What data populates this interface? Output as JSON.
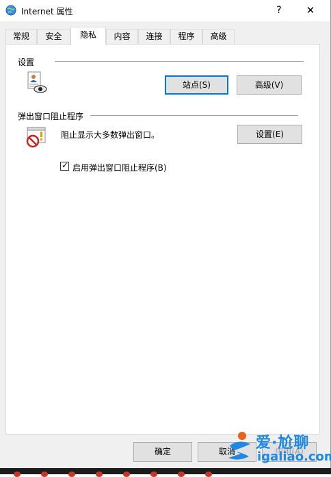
{
  "window": {
    "title": "Internet 属性",
    "help_glyph": "?",
    "close_glyph": "✕"
  },
  "tabs": [
    {
      "label": "常规"
    },
    {
      "label": "安全"
    },
    {
      "label": "隐私"
    },
    {
      "label": "内容"
    },
    {
      "label": "连接"
    },
    {
      "label": "程序"
    },
    {
      "label": "高级"
    }
  ],
  "active_tab": "隐私",
  "settings_group": {
    "label": "设置",
    "sites_button": "站点(S)",
    "advanced_button": "高级(V)"
  },
  "popup_group": {
    "label": "弹出窗口阻止程序",
    "description": "阻止显示大多数弹出窗口。",
    "settings_button": "设置(E)",
    "checkbox_label": "启用弹出窗口阻止程序(B)",
    "checkbox_checked": true,
    "checkbox_glyph": "✓"
  },
  "footer": {
    "ok_button": "确定",
    "cancel_button": "取消",
    "apply_button": "应用(A)"
  },
  "watermark": {
    "text": "爱·尬聊",
    "site": "igaliao.com"
  },
  "colors": {
    "accent": "#0078d7",
    "watermark": "#1e88e5"
  }
}
